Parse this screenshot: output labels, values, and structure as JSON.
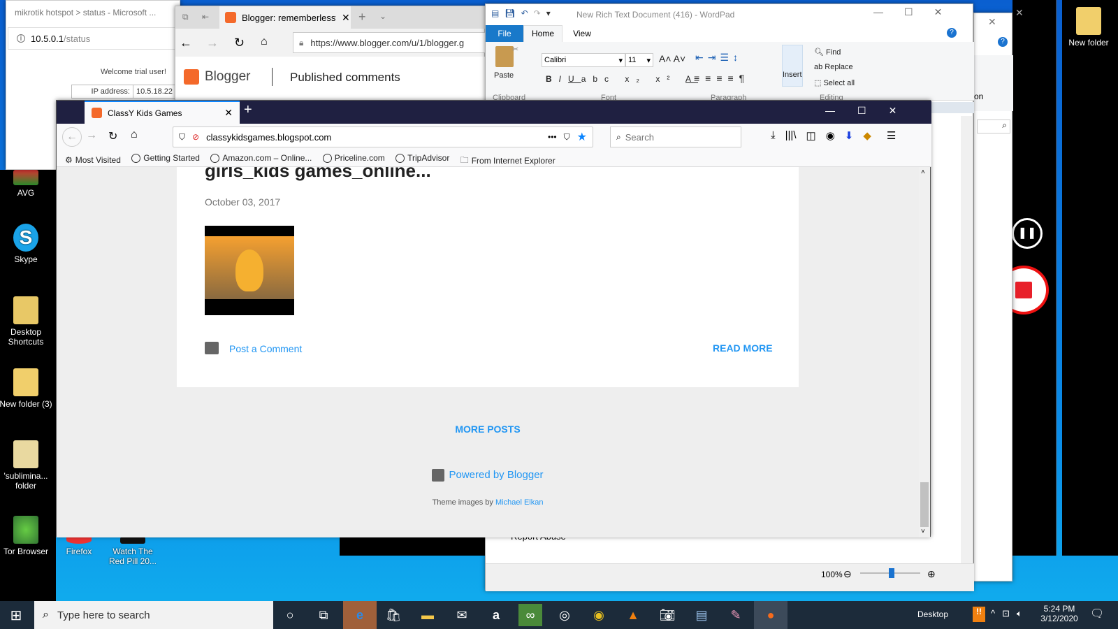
{
  "desktop": {
    "left_icons": [
      {
        "label": "AVG"
      },
      {
        "label": "Skype"
      },
      {
        "label": "Desktop Shortcuts"
      },
      {
        "label": "New folder (3)"
      },
      {
        "label": "'sublimina... folder"
      },
      {
        "label": "Tor Browser"
      }
    ],
    "bottom_icons": [
      {
        "label": "Firefox"
      },
      {
        "label": "Watch The Red Pill 20..."
      }
    ],
    "top_right_icon": {
      "label": "New folder"
    }
  },
  "edge_status": {
    "title": "mikrotik hotspot > status - Microsoft ...",
    "url_host": "10.5.0.1",
    "url_path": "/status",
    "welcome": "Welcome trial user!",
    "ip_label": "IP address:",
    "ip_value": "10.5.18.22"
  },
  "edge_blogger": {
    "tab_title": "Blogger: rememberlessf",
    "url": "https://www.blogger.com/u/1/blogger.g",
    "brand": "Blogger",
    "page_heading": "Published comments"
  },
  "wordpad": {
    "title": "New Rich Text Document (416) - WordPad",
    "tabs": [
      "File",
      "Home",
      "View"
    ],
    "paste": "Paste",
    "font_name": "Calibri",
    "font_size": "11",
    "insert": "Insert",
    "find": "Find",
    "replace": "Replace",
    "select_all": "Select all",
    "groups": [
      "Clipboard",
      "Font",
      "Paragraph",
      "Editing"
    ],
    "body_text": "Report Abuse",
    "zoom": "100%",
    "zoom_level_percent": 100
  },
  "behind_window": {
    "text_fragment": "on"
  },
  "firefox": {
    "tab_title": "ClassY Kids Games",
    "url": "classykidsgames.blogspot.com",
    "search_placeholder": "Search",
    "bookmarks": [
      "Most Visited",
      "Getting Started",
      "Amazon.com – Online...",
      "Priceline.com",
      "TripAdvisor",
      "From Internet Explorer"
    ],
    "post": {
      "title": "girls_kids games_online...",
      "date": "October 03, 2017",
      "post_comment": "Post a Comment",
      "read_more": "READ MORE"
    },
    "more_posts": "MORE POSTS",
    "powered_by": "Powered by Blogger",
    "theme_prefix": "Theme images by",
    "theme_author": "Michael Elkan",
    "accent": "#2196f3"
  },
  "taskbar": {
    "search_placeholder": "Type here to search",
    "desktop_label": "Desktop",
    "time": "5:24 PM",
    "date": "3/12/2020",
    "apps": [
      "cortana",
      "task-view",
      "edge",
      "store",
      "file-explorer",
      "mail",
      "amazon",
      "tripadvisor",
      "webcam-app",
      "color-app",
      "vlc",
      "camera",
      "wordpad",
      "paint",
      "firefox"
    ]
  }
}
